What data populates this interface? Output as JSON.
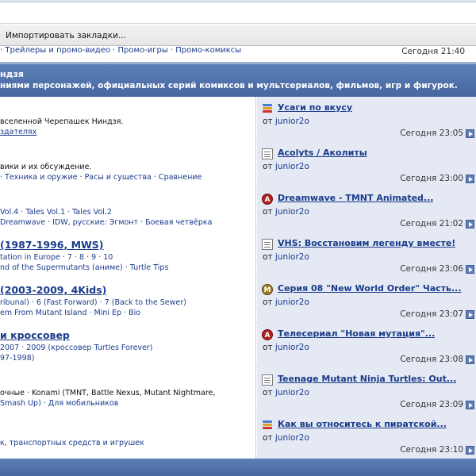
{
  "bookmarks": {
    "import_label": "Импортировать закладки..."
  },
  "top_row": {
    "links": "· Трейлеры и промо-видео · Промо-игры · Промо-комиксы",
    "time_day": "Сегодня",
    "time_clock": "21:40"
  },
  "category": {
    "title": "ндзя",
    "description": "ниями персонажей, официальных серий комиксов и мультсериалов, фильмов, игр и фигурок."
  },
  "forums": [
    {
      "title": "",
      "line1": "вселенной Черепашек Ниндзя.",
      "line2": "здателях",
      "last_title": "Усаги по вкусу",
      "by_prefix": "от",
      "user": "junior2o",
      "day": "Сегодня",
      "clock": "23:05",
      "icon": "bars-icon"
    },
    {
      "title": "",
      "line1": "вики и их обсуждение.",
      "line2": "· Техника и оружие · Расы и существа · Сравнение",
      "last_title": "Acolyts / Аколиты",
      "by_prefix": "от",
      "user": "junior2o",
      "day": "Сегодня",
      "clock": "23:00",
      "icon": "document-icon"
    },
    {
      "title": "",
      "line1": "",
      "line2": "Vol.4 · Tales Vol.1 · Tales Vol.2",
      "line3": "· IDW, русские: Эгмонт · Боевая четвёрка",
      "line3_prefix": "Dreamwave",
      "last_title": "Dreamwave - TMNT Animated...",
      "by_prefix": "от",
      "user": "junior2o",
      "day": "Сегодня",
      "clock": "21:02",
      "icon": "a-badge-icon"
    },
    {
      "title": "(1987-1996, MWS)",
      "line1": "tation in Europe · 7 · 8 · 9 · 10",
      "line2": "nd of the Supermutants (аниме) · Turtle Tips",
      "last_title": "VHS: Восстановим легенду вместе!",
      "by_prefix": "от",
      "user": "junior2o",
      "day": "Сегодня",
      "clock": "23:06",
      "icon": "document-icon"
    },
    {
      "title": "(2003-2009, 4Kids)",
      "line1": "ribunal) · 6 (Fast Forward) · 7 (Back to the Sewer)",
      "line2": "em From Mutant Island · Mini Ep · Bio",
      "last_title": "Серия 08 \"New World Order\" Часть...",
      "by_prefix": "от",
      "user": "junior2o",
      "day": "Сегодня",
      "clock": "23:07",
      "icon": "m-badge-icon"
    },
    {
      "title": "и кроссовер",
      "line1": "2007 · 2009 (кроссовер Turtles Forever)",
      "line2": "97-1998)",
      "last_title": "Телесериал \"Новая мутация\"...",
      "by_prefix": "от",
      "user": "junior2o",
      "day": "Сегодня",
      "clock": "23:08",
      "icon": "a-badge-icon"
    },
    {
      "title": "",
      "line1": "очные · Konami (TMNT, Battle Nexus, Mutant Nightmare,",
      "line2": "Smash Up) · Для мобильников",
      "last_title": "Teenage Mutant Ninja Turtles: Out...",
      "by_prefix": "от",
      "user": "junior2o",
      "day": "Сегодня",
      "clock": "23:09",
      "icon": "document-icon"
    },
    {
      "title": "",
      "line1": "",
      "line2": "к, транспортных средств и игрушек",
      "last_title": "Как вы относитесь к пиратской...",
      "by_prefix": "от",
      "user": "junior2o",
      "day": "Сегодня",
      "clock": "23:10",
      "icon": "bars-icon"
    }
  ],
  "colors": {
    "link": "#1a3b8a",
    "header_blue": "#46679f",
    "row_alt": "#e4e9f4"
  }
}
